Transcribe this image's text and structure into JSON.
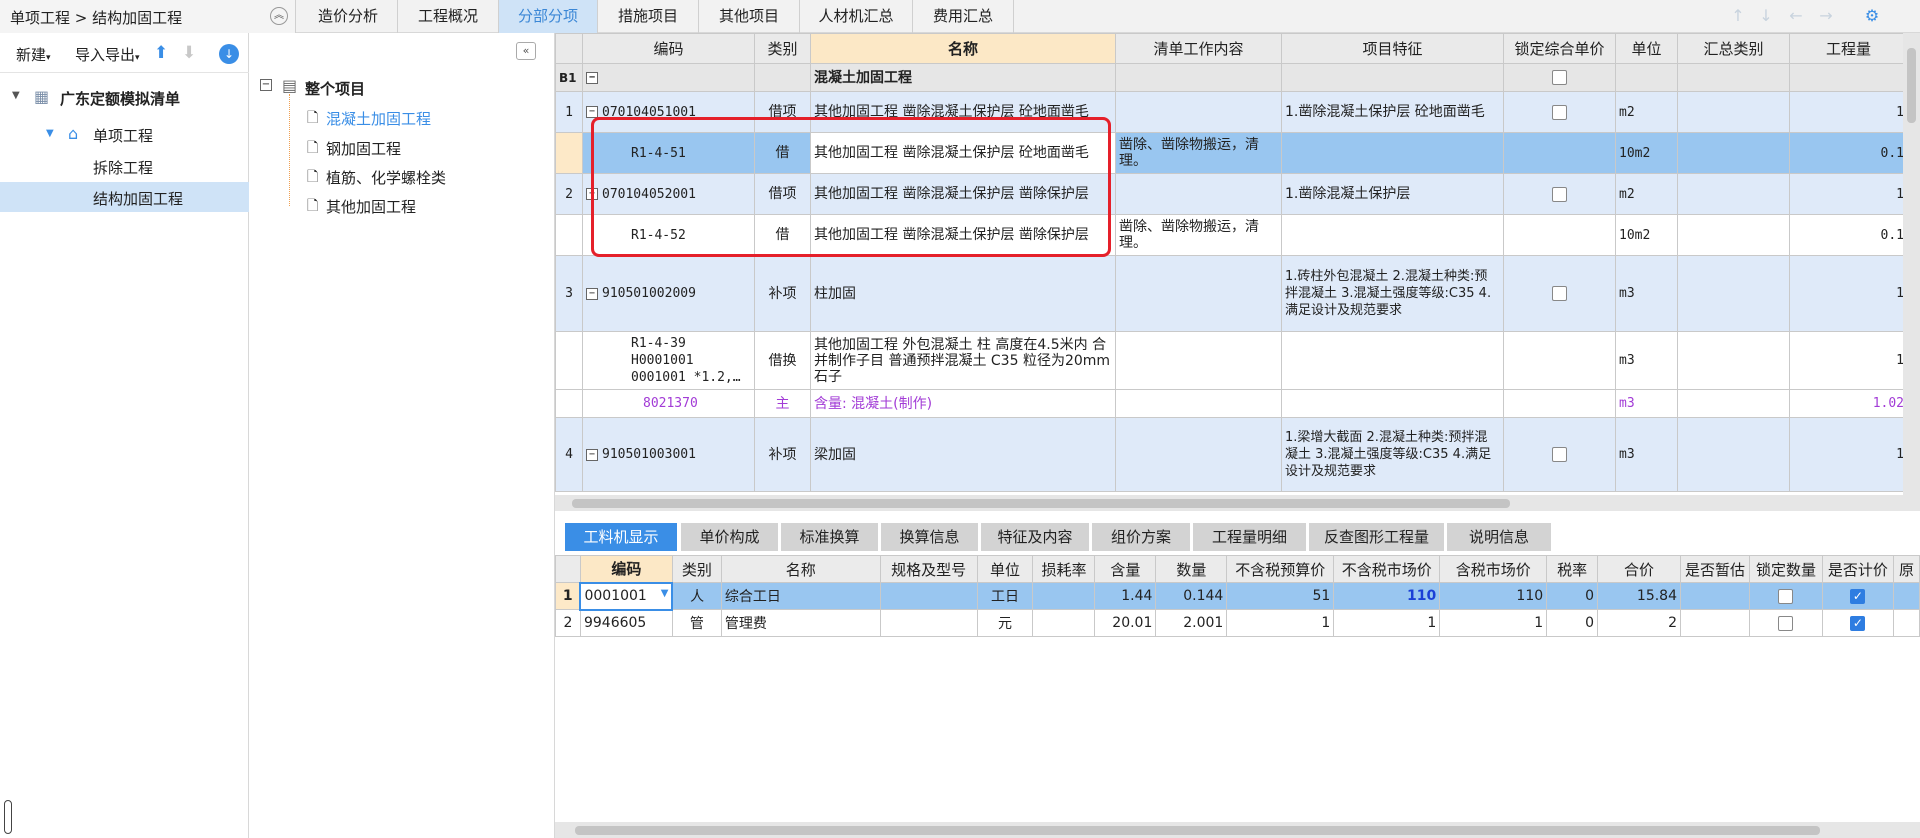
{
  "breadcrumb": "单项工程 > 结构加固工程",
  "tabs": [
    "造价分析",
    "工程概况",
    "分部分项",
    "措施项目",
    "其他项目",
    "人材机汇总",
    "费用汇总"
  ],
  "toolbar": {
    "new": "新建",
    "io": "导入导出"
  },
  "left_tree": {
    "root": "广东定额模拟清单",
    "single": "单项工程",
    "items": [
      "拆除工程",
      "结构加固工程"
    ]
  },
  "mid_tree": {
    "root": "整个项目",
    "items": [
      "混凝土加固工程",
      "钢加固工程",
      "植筋、化学螺栓类",
      "其他加固工程"
    ]
  },
  "grid": {
    "headers": [
      "编码",
      "类别",
      "名称",
      "清单工作内容",
      "项目特征",
      "锁定综合单价",
      "单位",
      "汇总类别",
      "工程量"
    ],
    "group": {
      "id": "B1",
      "name": "混凝土加固工程"
    },
    "rows": [
      {
        "no": "1",
        "code": "070104051001",
        "type": "借项",
        "name": "其他加固工程 凿除混凝土保护层 砼地面凿毛",
        "work": "",
        "feature": "1.凿除混凝土保护层 砼地面凿毛",
        "unit": "m2",
        "qty": "1"
      },
      {
        "no": "",
        "code": "R1-4-51",
        "type": "借",
        "name": "其他加固工程 凿除混凝土保护层 砼地面凿毛",
        "work": "凿除、凿除物搬运，清理。",
        "feature": "",
        "unit": "10m2",
        "qty": "0.1"
      },
      {
        "no": "2",
        "code": "070104052001",
        "type": "借项",
        "name": "其他加固工程 凿除混凝土保护层 凿除保护层",
        "work": "",
        "feature": "1.凿除混凝土保护层",
        "unit": "m2",
        "qty": "1"
      },
      {
        "no": "",
        "code": "R1-4-52",
        "type": "借",
        "name": "其他加固工程 凿除混凝土保护层 凿除保护层",
        "work": "凿除、凿除物搬运，清理。",
        "feature": "",
        "unit": "10m2",
        "qty": "0.1"
      },
      {
        "no": "3",
        "code": "910501002009",
        "type": "补项",
        "name": "柱加固",
        "work": "",
        "feature": "1.砖柱外包混凝土\n2.混凝土种类:预拌混凝土\n3.混凝土强度等级:C35\n4.满足设计及规范要求",
        "unit": "m3",
        "qty": "1"
      },
      {
        "no": "",
        "code": "R1-4-39\nH0001001\n0001001 *1.2,…",
        "type": "借换",
        "name": "其他加固工程 外包混凝土 柱  高度在4.5米内  合并制作子目 普通预拌混凝土 C35 粒径为20mm石子",
        "work": "",
        "feature": "",
        "unit": "m3",
        "qty": "1"
      },
      {
        "no": "",
        "code": "8021370",
        "type": "主",
        "name": "含量: 混凝土(制作)",
        "work": "",
        "feature": "",
        "unit": "m3",
        "qty": "1.02"
      },
      {
        "no": "4",
        "code": "910501003001",
        "type": "补项",
        "name": "梁加固",
        "work": "",
        "feature": "1.梁增大截面\n2.混凝土种类:预拌混凝土\n3.混凝土强度等级:C35\n4.满足设计及规范要求",
        "unit": "m3",
        "qty": "1"
      }
    ]
  },
  "bottom_tabs": [
    "工料机显示",
    "单价构成",
    "标准换算",
    "换算信息",
    "特征及内容",
    "组价方案",
    "工程量明细",
    "反查图形工程量",
    "说明信息"
  ],
  "detail": {
    "headers": [
      "编码",
      "类别",
      "名称",
      "规格及型号",
      "单位",
      "损耗率",
      "含量",
      "数量",
      "不含税预算价",
      "不含税市场价",
      "含税市场价",
      "税率",
      "合价",
      "是否暂估",
      "锁定数量",
      "是否计价",
      "原"
    ],
    "rows": [
      {
        "no": "1",
        "code": "0001001",
        "type": "人",
        "name": "综合工日",
        "spec": "",
        "unit": "工日",
        "loss": "",
        "content": "1.44",
        "qty": "0.144",
        "budget": "51",
        "market": "110",
        "market_tax": "110",
        "rate": "0",
        "total": "15.84"
      },
      {
        "no": "2",
        "code": "9946605",
        "type": "管",
        "name": "管理费",
        "spec": "",
        "unit": "元",
        "loss": "",
        "content": "20.01",
        "qty": "2.001",
        "budget": "1",
        "market": "1",
        "market_tax": "1",
        "rate": "0",
        "total": "2"
      }
    ]
  }
}
